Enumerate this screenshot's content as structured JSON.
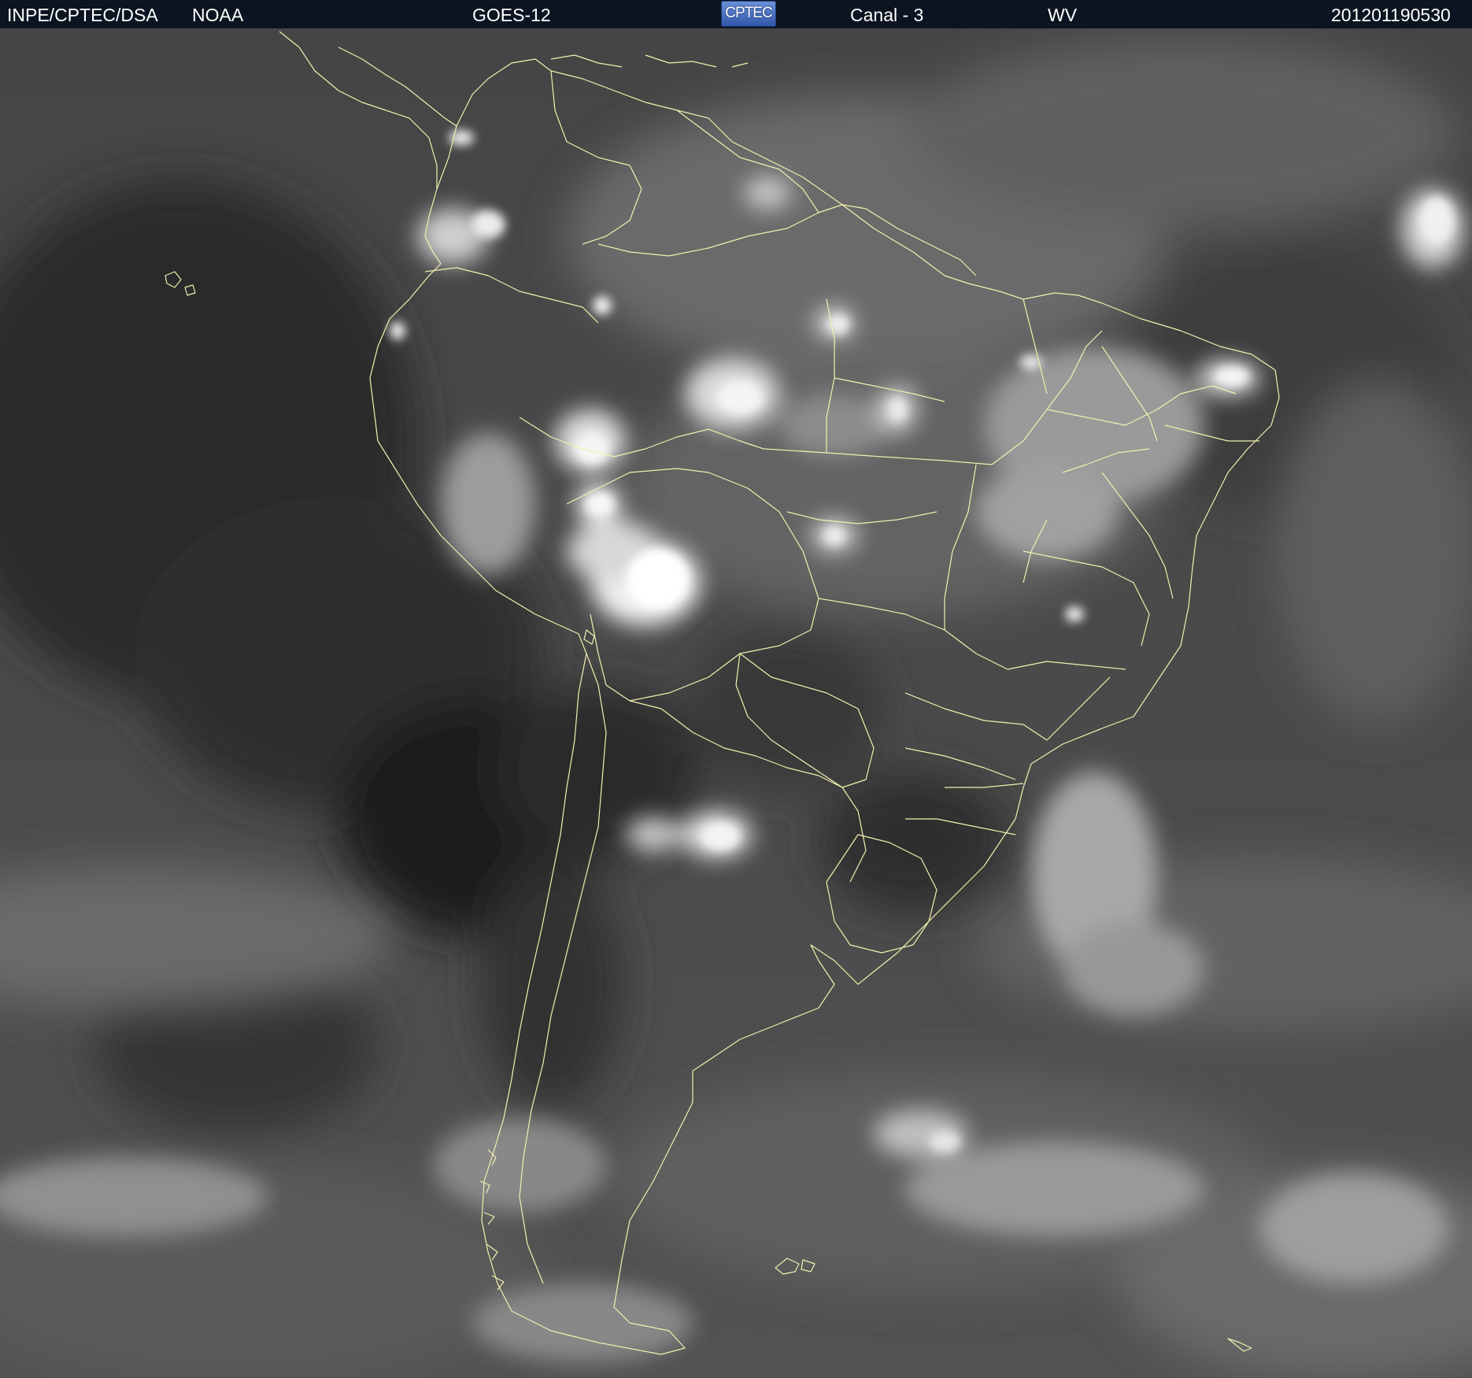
{
  "header": {
    "agency": "INPE/CPTEC/DSA",
    "provider": "NOAA",
    "satellite": "GOES-12",
    "logo_text": "CPTEC",
    "channel": "Canal - 3",
    "band": "WV",
    "timestamp": "201201190530"
  },
  "colors": {
    "header_background": "#0b1420",
    "header_text": "#ffffff",
    "border_lines": "#f0f0b0",
    "image_background": "#505050"
  },
  "image": {
    "type": "water-vapor satellite image",
    "region": "South America",
    "grayscale": true
  }
}
